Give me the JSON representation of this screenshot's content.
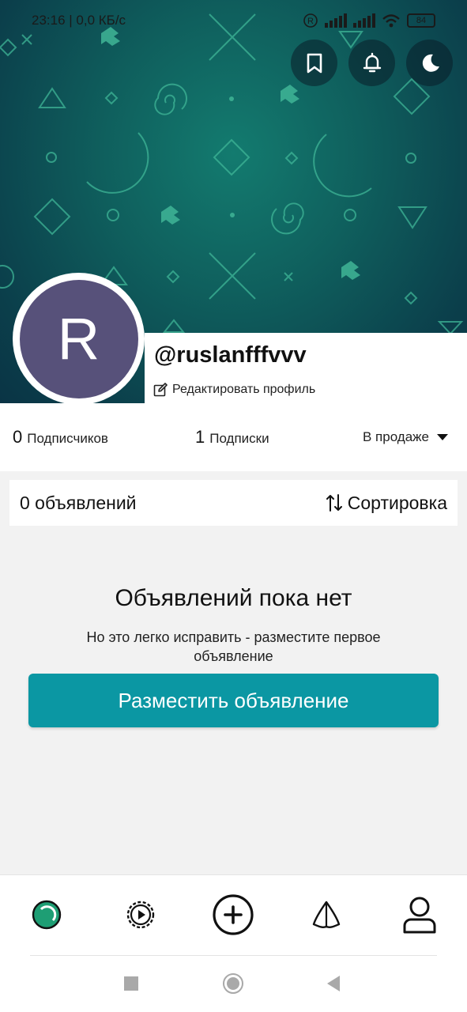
{
  "status_bar": {
    "time_and_speed": "23:16 | 0,0 КБ/с",
    "battery": "84"
  },
  "profile": {
    "avatar_letter": "R",
    "username": "@ruslanfffvvv",
    "edit_label": "Редактировать профиль"
  },
  "stats": {
    "followers_count": "0",
    "followers_label": "Подписчиков",
    "following_count": "1",
    "following_label": "Подписки",
    "filter_label": "В продаже"
  },
  "ads": {
    "count_label": "0 объявлений",
    "sort_label": "Сортировка"
  },
  "empty_state": {
    "title": "Объявлений пока нет",
    "subtitle": "Но это легко исправить - разместите первое объявление",
    "cta_label": "Разместить объявление"
  },
  "bottom_nav": {
    "items": [
      "home-icon",
      "video-icon",
      "add-icon",
      "map-icon",
      "profile-icon"
    ],
    "active_color": "#1e9e74"
  },
  "colors": {
    "banner_teal": "#0f5f5d",
    "avatar_bg": "#57517a",
    "cta_bg": "#0b97a3"
  }
}
